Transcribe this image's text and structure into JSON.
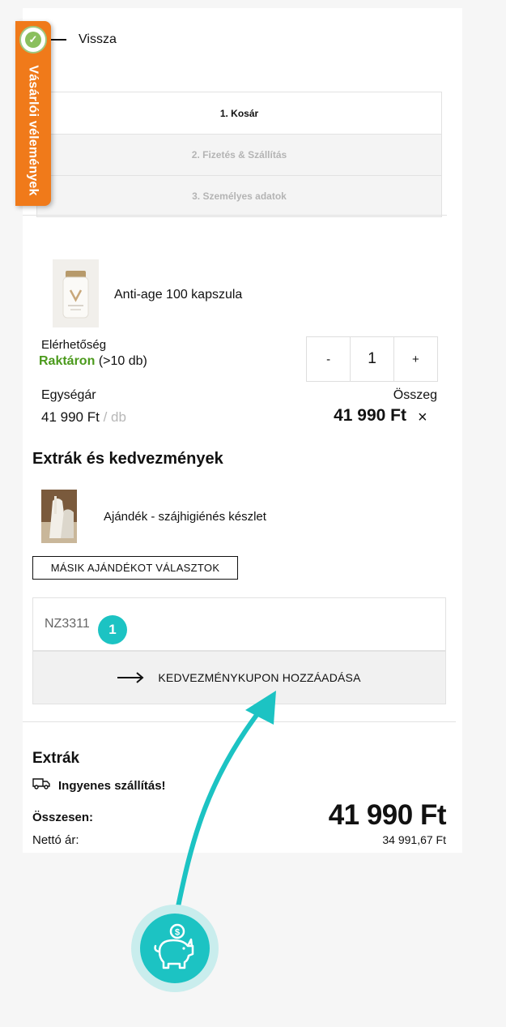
{
  "back": {
    "label": "Vissza"
  },
  "badge": {
    "text": "Vásárlói vélemények",
    "color": "#f07a1a"
  },
  "steps": [
    {
      "label": "1. Kosár",
      "active": true
    },
    {
      "label": "2. Fizetés & Szállítás",
      "active": false
    },
    {
      "label": "3. Személyes adatok",
      "active": false
    }
  ],
  "product": {
    "name": "Anti-age 100 kapszula",
    "availability_label": "Elérhetőség",
    "availability_status": "Raktáron",
    "availability_detail": "(>10 db)",
    "quantity": "1",
    "qty_minus": "-",
    "qty_plus": "+",
    "unit_price_label": "Egységár",
    "unit_price": "41 990 Ft",
    "unit_suffix": "/ db",
    "sum_label": "Összeg",
    "sum_value": "41 990 Ft",
    "remove_icon": "×"
  },
  "extras_section": {
    "title": "Extrák és kedvezmények",
    "gift_name": "Ajándék - szájhigiénés készlet",
    "gift_button": "MÁSIK AJÁNDÉKOT VÁLASZTOK"
  },
  "coupon": {
    "value": "NZ3311",
    "step_marker": "1",
    "button_label": "KEDVEZMÉNYKUPON HOZZÁADÁSA"
  },
  "summary": {
    "extras_title": "Extrák",
    "shipping_label": "Ingyenes szállítás!",
    "total_label": "Összesen:",
    "total_value": "41 990 Ft",
    "net_label": "Nettó ár:",
    "net_value": "34 991,67 Ft"
  },
  "colors": {
    "accent": "#1cc3c3",
    "in_stock": "#4b9a1c",
    "badge": "#f07a1a"
  },
  "icons": [
    "back-line-icon",
    "verified-seal-icon",
    "minus-icon",
    "plus-icon",
    "close-icon",
    "arrow-right-icon",
    "truck-icon",
    "piggy-bank-icon"
  ]
}
